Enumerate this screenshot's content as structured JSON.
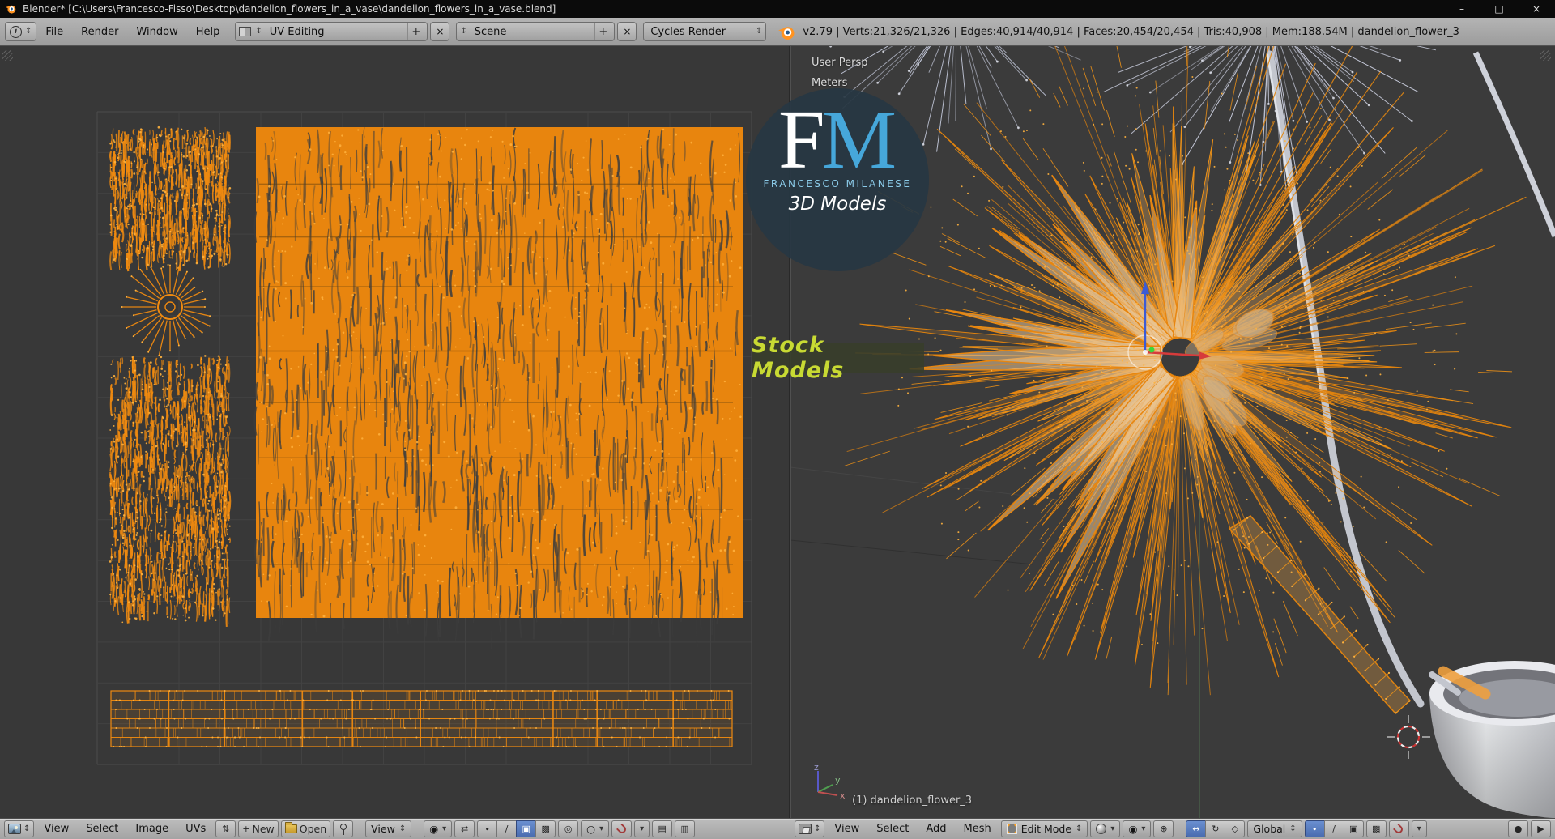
{
  "window": {
    "title": "Blender* [C:\\Users\\Francesco-Fisso\\Desktop\\dandelion_flowers_in_a_vase\\dandelion_flowers_in_a_vase.blend]"
  },
  "topbar": {
    "menus": [
      "File",
      "Render",
      "Window",
      "Help"
    ],
    "layout": "UV Editing",
    "scene": "Scene",
    "engine": "Cycles Render",
    "stats": "v2.79 | Verts:21,326/21,326 | Edges:40,914/40,914 | Faces:20,454/20,454 | Tris:40,908 | Mem:188.54M | dandelion_flower_3"
  },
  "uv_header": {
    "menus": [
      "View",
      "Select",
      "Image",
      "UVs"
    ],
    "new_button": "New",
    "open_button": "Open",
    "display_dropdown": "View"
  },
  "vp_header": {
    "menus": [
      "View",
      "Select",
      "Add",
      "Mesh"
    ],
    "mode": "Edit Mode",
    "orientation": "Global"
  },
  "viewport": {
    "persp_label": "User Persp",
    "units_label": "Meters",
    "object_label": "(1) dandelion_flower_3",
    "axis": {
      "x": "x",
      "y": "y",
      "z": "z"
    }
  },
  "watermark": {
    "f": "F",
    "m": "M",
    "line1": "FRANCESCO MILANESE",
    "line2": "3D Models",
    "badge": "Stock Models"
  },
  "icons": {
    "info": "i",
    "updown": "↕",
    "dropdown": "▾",
    "plus": "+",
    "close": "×",
    "minimize": "–",
    "maximize": "□",
    "browse": "⇅",
    "sync": "⇄",
    "pivot": "◉",
    "vertex": "∙",
    "edge": "/",
    "face": "▣",
    "island": "▩",
    "sticky": "◎",
    "proportional": "○",
    "translate": "↔",
    "rotate": "↻",
    "scale": "◇",
    "align": "⊕",
    "occlude": "▩",
    "slot_a": "▤",
    "slot_b": "▥",
    "render_still": "●",
    "render_anim": "▶"
  },
  "colors": {
    "uv_orange": "#ef8a10",
    "uv_orange_fill": "#e8850e",
    "uv_dot": "#ffb23e",
    "grid_line": "#424242",
    "select_blue": "#4a6cb0"
  }
}
